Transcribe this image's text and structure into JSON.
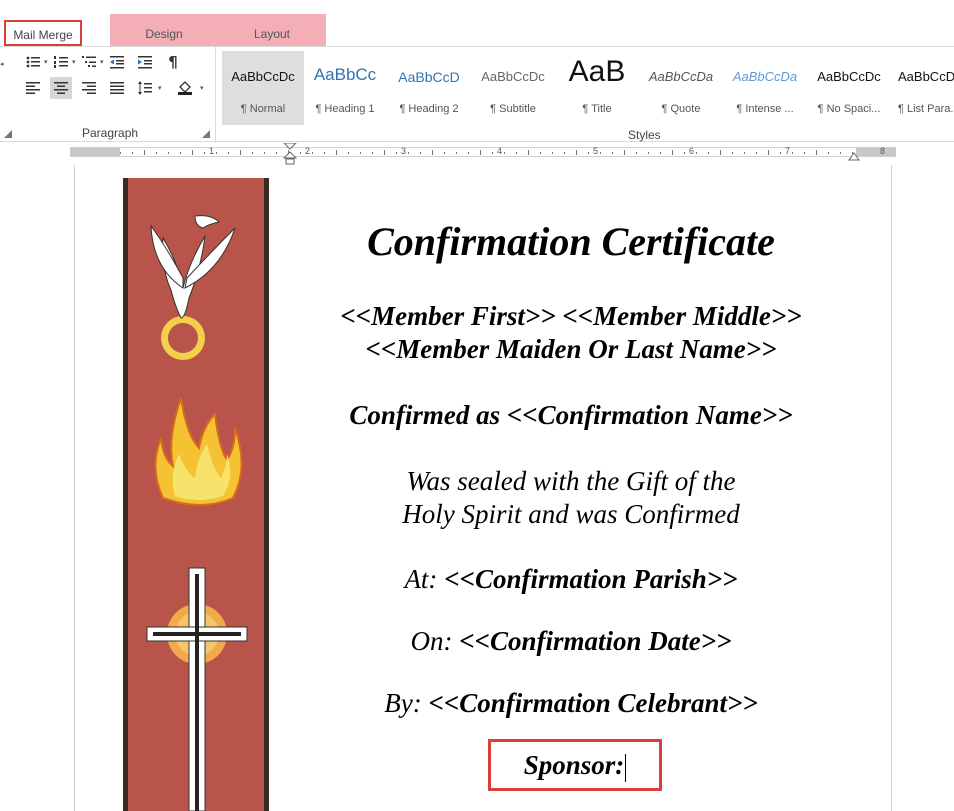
{
  "tabs": {
    "mail_merge": "Mail Merge",
    "design": "Design",
    "layout": "Layout"
  },
  "ribbon": {
    "paragraph_label": "Paragraph",
    "styles_label": "Styles",
    "paragraph_buttons": [
      "bullets-icon",
      "numbering-icon",
      "multilevel-list-icon",
      "decrease-indent-icon",
      "increase-indent-icon",
      "show-formatting-marks-icon",
      "align-left-icon",
      "align-center-icon",
      "align-right-icon",
      "justify-icon",
      "line-spacing-icon",
      "shading-icon"
    ],
    "styles": [
      {
        "preview": "AaBbCcDc",
        "name": "¶ Normal"
      },
      {
        "preview": "AaBbCc",
        "name": "¶ Heading 1"
      },
      {
        "preview": "AaBbCcD",
        "name": "¶ Heading 2"
      },
      {
        "preview": "AaBbCcDc",
        "name": "¶ Subtitle"
      },
      {
        "preview": "AaB",
        "name": "¶ Title"
      },
      {
        "preview": "AaBbCcDa",
        "name": "¶ Quote"
      },
      {
        "preview": "AaBbCcDa",
        "name": "¶ Intense ..."
      },
      {
        "preview": "AaBbCcDc",
        "name": "¶ No Spaci..."
      },
      {
        "preview": "AaBbCcDc",
        "name": "¶ List Para..."
      }
    ]
  },
  "ruler": {
    "numbers": [
      "1",
      "2",
      "3",
      "4",
      "5",
      "6",
      "7",
      "8"
    ]
  },
  "document": {
    "title": "Confirmation Certificate",
    "member_line_1": "<<Member First>> <<Member Middle>>",
    "member_line_2": "<<Member Maiden Or Last Name>>",
    "confirmed_as": "Confirmed as <<Confirmation Name>>",
    "sealed_line_1": "Was sealed with the Gift of the",
    "sealed_line_2": "Holy Spirit and was Confirmed",
    "at_label": "At: ",
    "at_value": "<<Confirmation Parish>>",
    "on_label": "On: ",
    "on_value": "<<Confirmation Date>>",
    "by_label": "By: ",
    "by_value": "<<Confirmation Celebrant>>",
    "sponsor": "Sponsor:"
  },
  "colors": {
    "highlight_border": "#d9403a",
    "tab_accent": "#f3afb5",
    "banner_red": "#c1574c"
  }
}
